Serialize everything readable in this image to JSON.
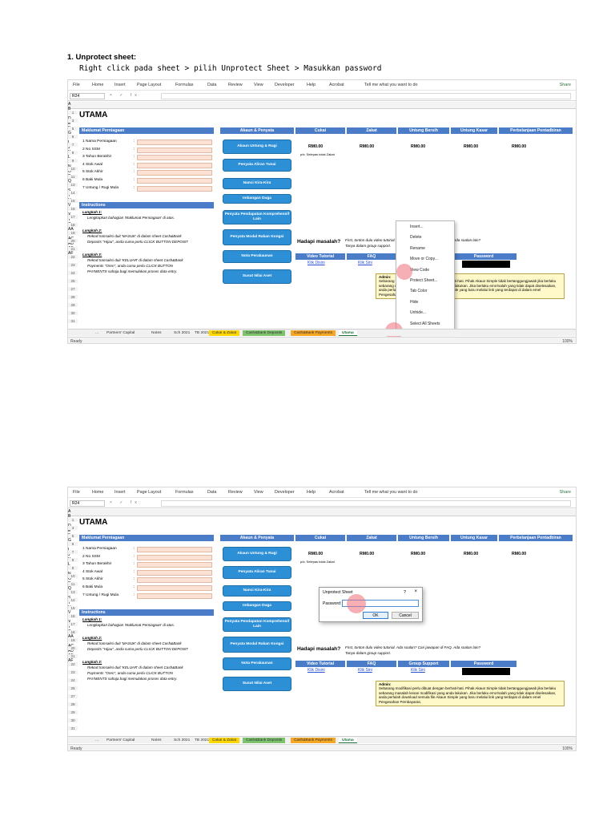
{
  "instruction": {
    "title": "1.  Unprotect sheet:",
    "subtitle": "Right click pada sheet > pilih Unprotect Sheet > Masukkan password"
  },
  "ribbon": {
    "tabs": [
      "File",
      "Home",
      "Insert",
      "Page Layout",
      "Formulas",
      "Data",
      "Review",
      "View",
      "Developer",
      "Help",
      "Acrobat"
    ],
    "tell_me": "Tell me what you want to do",
    "share": "Share"
  },
  "formula_bar": {
    "name_box": "R24",
    "icons": "× ✓ fx"
  },
  "columns": [
    "A",
    "B",
    "C",
    "D",
    "E",
    "F",
    "G",
    "H",
    "I",
    "J",
    "K",
    "L",
    "M",
    "N",
    "O",
    "P",
    "Q",
    "R",
    "S",
    "T",
    "U",
    "V",
    "W",
    "X",
    "Y",
    "Z",
    "AA",
    "AB",
    "AC",
    "AD",
    "AE",
    "AF"
  ],
  "rows": [
    "1",
    "3",
    "5",
    "6",
    "7",
    "8",
    "9",
    "10",
    "11",
    "13",
    "14",
    "15",
    "16",
    "17",
    "18",
    "19",
    "20",
    "21",
    "22",
    "23",
    "24",
    "25",
    "27",
    "28",
    "29",
    "30",
    "31"
  ],
  "sheet": {
    "title": "UTAMA",
    "maklumat_header": "Maklumat Perniagaan",
    "info_items": [
      "1 Nama Perniagaan",
      "2 No SSM",
      "3 Tahun Berakhir",
      "4 Stok Awal",
      "5 Stok Akhir",
      "6 Baki Mula",
      "7 Untung / Rugi Mula"
    ],
    "colon": ":",
    "instructions_header": "Instructions",
    "steps": [
      {
        "label": "Langkah 1:",
        "lines": [
          "Lengkapkan bahagian 'Maklumat Perniagaan' di atas."
        ]
      },
      {
        "label": "Langkah 2:",
        "lines": [
          "Rekod transaksi duit 'MASUK' di dalam sheet Cash&Bank",
          "Deposits \"Hijau\", anda cuma perlu  CLICK BUTTON DEPOSIT"
        ]
      },
      {
        "label": "Langkah 3:",
        "lines": [
          "Rekod transaksi duit 'KELUAR' di dalam sheet Cash&Bank",
          "Payments \"Oren\", anda cuma perlu  CLICK BUTTON",
          "PAYMENTS sahaja bagi memulakan proses data entry."
        ]
      }
    ],
    "akaun_header": "Akaun & Penyata",
    "buttons": [
      "Akaun Untung & Rugi",
      "Penyata Aliran Tunai",
      "Nanci Kira-Kira",
      "Imbangan Duga",
      "Penyata Pendapatan Komprehensif Lain",
      "Penyata Modal Rakan Kongsi",
      "Nota Perakaunan",
      "Susut Nilai Aset"
    ],
    "summary_headers": [
      "Cukai",
      "Zakat",
      "Untung Bersih",
      "Untung Kasar",
      "Perbelanjaan Pentadbiran"
    ],
    "summary_values": [
      "RM0.00",
      "RM0.00",
      "RM0.00",
      "RM0.00",
      "RM0.00"
    ],
    "zakat_note": "p/s: Selepas tolak Zakat",
    "hadapi": "Hadapi masalah?",
    "first_line": "First, tonton dulu video tutorial. Ada soalan? Cari jawapan di FAQ. Ada soalan lain?",
    "second_line": "Tanya dalam group support.",
    "support_headers": [
      "Video Tutorial",
      "FAQ",
      "Group Support",
      "Password"
    ],
    "links": [
      "Klik Disini",
      "Klik Sini",
      "Klik Sini"
    ],
    "admin_title": "Admin:",
    "admin_text": "Sebarang modifikasi perlu dibuat dengan berhati-hati. Pihak Akaun Simple tidak bertanggungjawab jika berlaku sebarang masalah kesan modifikasi yang anda lakukan. Jika berlaku error/salah yang tidak dapat diselesaikan, anda perlulah download semula file Akaun Simple yang baru melalui link yang terdapat di dalam emel Pengesahan Pembayaran."
  },
  "sheet_tabs": [
    "...",
    "Partners' Capital",
    "Notes",
    "Sch 2021",
    "TB 2021",
    "Cukai & Zakat",
    "Cash&Bank Deposits",
    "Cash&Bank Payments",
    "Utama"
  ],
  "sheet_tab_colors": {
    "cukai": "#ffd700",
    "deposits": "#7dc36e",
    "payments": "#f5a623"
  },
  "status": {
    "ready": "Ready",
    "zoom": "100%"
  },
  "context_menu": [
    "Insert...",
    "Delete",
    "Rename",
    "Move or Copy...",
    "View Code",
    "Protect Sheet...",
    "Tab Color",
    "Hide",
    "Unhide...",
    "Select All Sheets"
  ],
  "dialog": {
    "title": "Unprotect Sheet",
    "help": "?",
    "close": "×",
    "password_label": "Password:",
    "ok": "OK",
    "cancel": "Cancel"
  }
}
